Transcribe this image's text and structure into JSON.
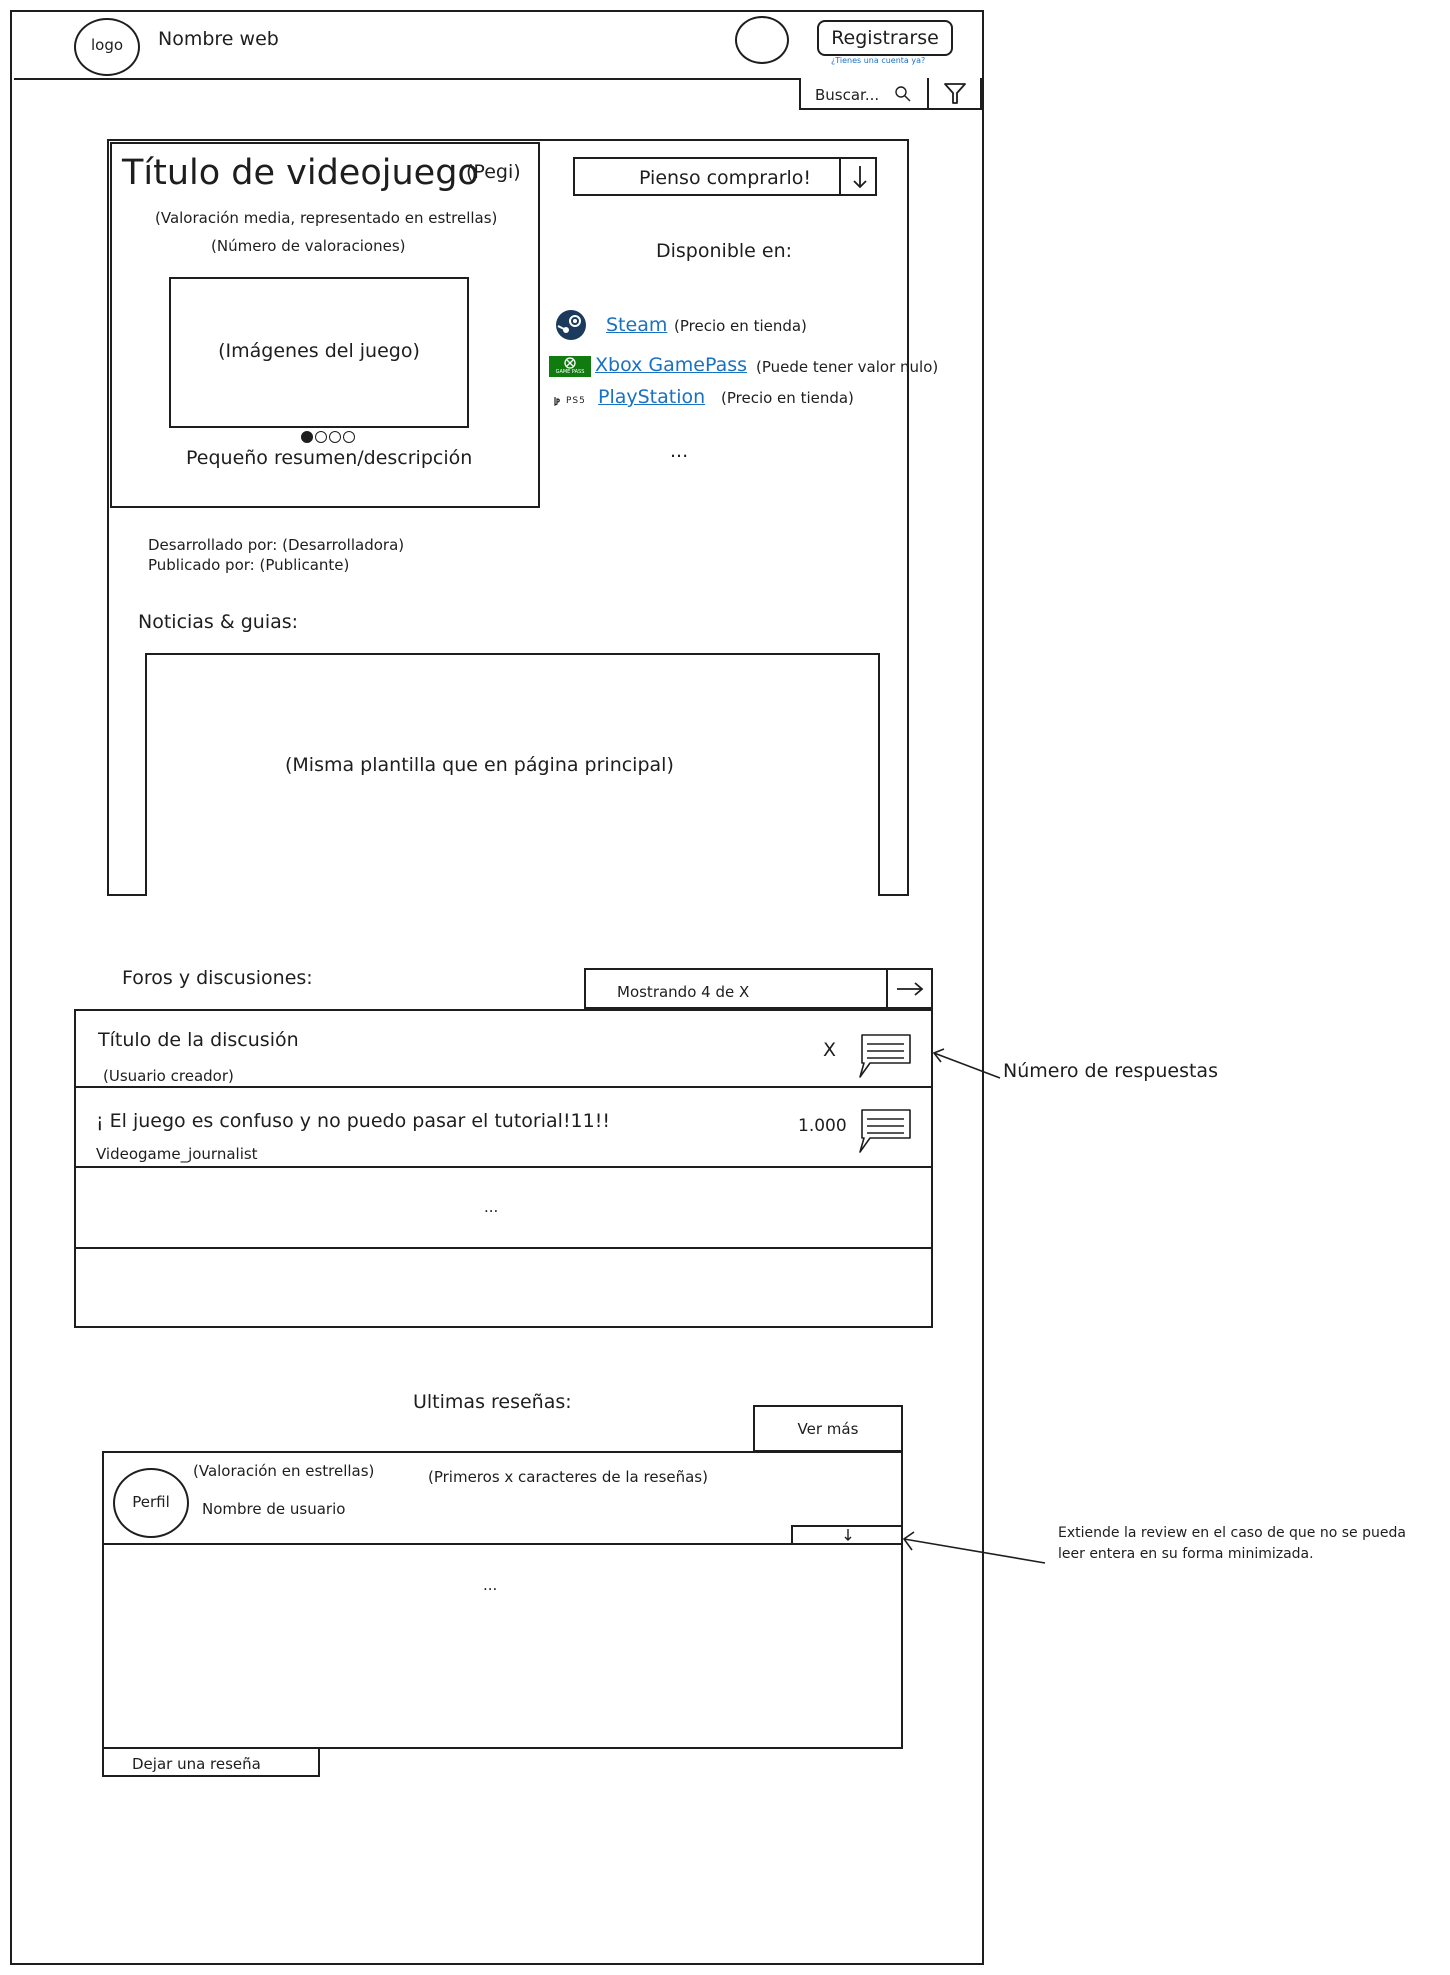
{
  "header": {
    "logo": "logo",
    "site_name": "Nombre web",
    "register_button": "Registrarse",
    "register_hint": "¿Tienes una cuenta ya?",
    "search_placeholder": "Buscar..."
  },
  "game": {
    "title": "Título de videojuego",
    "pegi": "(Pegi)",
    "rating": "(Valoración media, representado en estrellas)",
    "rating_count": "(Número de valoraciones)",
    "images": "(Imágenes del juego)",
    "carousel_total": 4,
    "carousel_current": 1,
    "summary": "Pequeño resumen/descripción",
    "wishlist": "Pienso comprarlo!",
    "available_label": "Disponible en:",
    "stores": [
      {
        "name": "Steam",
        "note": "(Precio en tienda)",
        "icon": "steam-icon"
      },
      {
        "name": "Xbox GamePass",
        "note": "(Puede tener valor nulo)",
        "icon": "xbox-gamepass-icon",
        "icon_text": "GAME PASS"
      },
      {
        "name": "PlayStation",
        "note": "(Precio en tienda)",
        "icon": "playstation-icon",
        "icon_text": "PS5"
      }
    ],
    "stores_more": "...",
    "developer": "Desarrollado por: (Desarrolladora)",
    "publisher": "Publicado por: (Publicante)",
    "news_label": "Noticias & guias:",
    "news_placeholder": "(Misma plantilla que en página principal)"
  },
  "forums": {
    "label": "Foros y discusiones:",
    "showing": "Mostrando 4 de X",
    "threads": [
      {
        "title": "Título de la discusión",
        "author": "(Usuario creador)",
        "replies": "X"
      },
      {
        "title": "¡ El juego es confuso y no puedo pasar el tutorial!11!!",
        "author": "Videogame_journalist",
        "replies": "1.000"
      }
    ],
    "more": "...",
    "annotation": "Número de respuestas"
  },
  "reviews": {
    "label": "Ultimas reseñas:",
    "see_more": "Ver más",
    "avatar": "Perfil",
    "stars": "(Valoración en estrellas)",
    "username": "Nombre de usuario",
    "excerpt": "(Primeros x caracteres de la reseñas)",
    "more": "...",
    "leave_review": "Dejar una reseña",
    "annotation_line1": "Extiende la review en el caso de que no se pueda",
    "annotation_line2": "leer entera en su forma minimizada."
  },
  "colors": {
    "ink": "#1e1e1e",
    "link": "#1971c2",
    "steam": "#1b3a5c",
    "xbox": "#107c10"
  }
}
